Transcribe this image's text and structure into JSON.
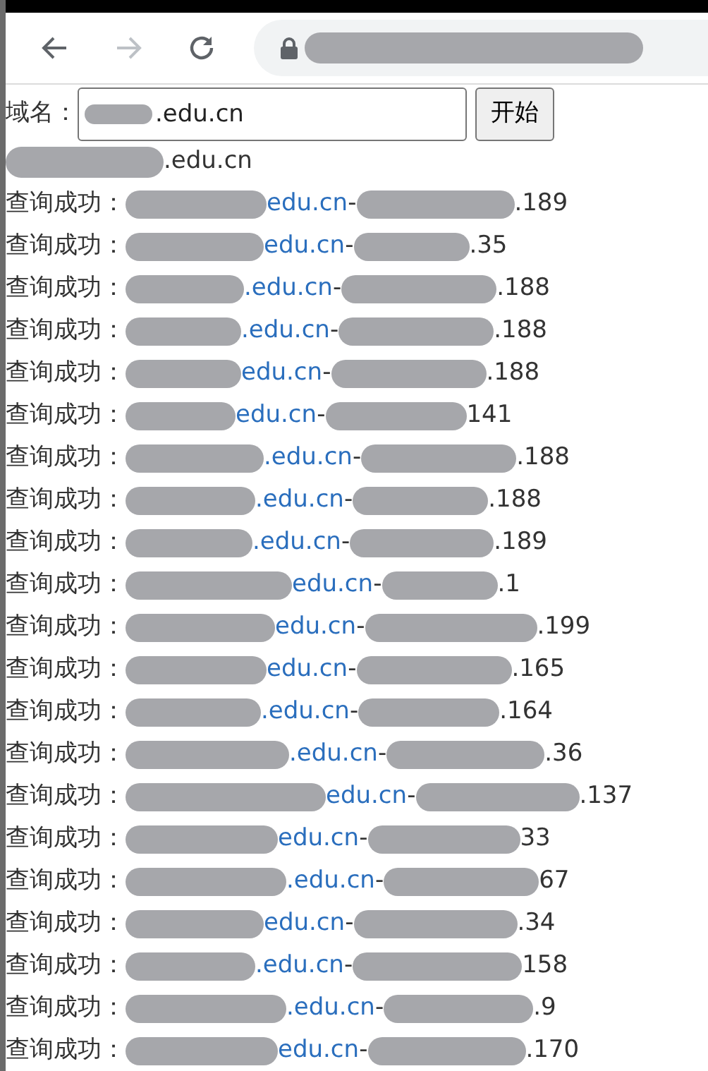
{
  "toolbar": {
    "back_enabled": true,
    "forward_enabled": false
  },
  "form": {
    "label": "域名：",
    "value": ".edu.cn",
    "button": "开始"
  },
  "query_domain": ".edu.cn",
  "results": [
    {
      "label": "查询成功：",
      "domain": "edu.cn",
      "sep": "-",
      "ip": ".189"
    },
    {
      "label": "查询成功：",
      "domain": "edu.cn",
      "sep": "-",
      "ip": ".35"
    },
    {
      "label": "查询成功：",
      "domain": ".edu.cn",
      "sep": "-",
      "ip": ".188"
    },
    {
      "label": "查询成功：",
      "domain": ".edu.cn",
      "sep": "-",
      "ip": ".188"
    },
    {
      "label": "查询成功：",
      "domain": "edu.cn",
      "sep": "-",
      "ip": ".188"
    },
    {
      "label": "查询成功：",
      "domain": "edu.cn",
      "sep": "-",
      "ip": "141"
    },
    {
      "label": "查询成功：",
      "domain": ".edu.cn",
      "sep": "-",
      "ip": ".188"
    },
    {
      "label": "查询成功：",
      "domain": ".edu.cn",
      "sep": "-",
      "ip": ".188"
    },
    {
      "label": "查询成功：",
      "domain": ".edu.cn",
      "sep": "-",
      "ip": ".189"
    },
    {
      "label": "查询成功：",
      "domain": "edu.cn",
      "sep": "-",
      "ip": ".1"
    },
    {
      "label": "查询成功：",
      "domain": "edu.cn",
      "sep": "-",
      "ip": ".199"
    },
    {
      "label": "查询成功：",
      "domain": "edu.cn",
      "sep": "-",
      "ip": ".165"
    },
    {
      "label": "查询成功：",
      "domain": ".edu.cn",
      "sep": "-",
      "ip": ".164"
    },
    {
      "label": "查询成功：",
      "domain": ".edu.cn",
      "sep": "-",
      "ip": ".36"
    },
    {
      "label": "查询成功：",
      "domain": "edu.cn",
      "sep": "-",
      "ip": ".137"
    },
    {
      "label": "查询成功：",
      "domain": "edu.cn",
      "sep": "-",
      "ip": "33"
    },
    {
      "label": "查询成功：",
      "domain": ".edu.cn",
      "sep": "-",
      "ip": "67"
    },
    {
      "label": "查询成功：",
      "domain": "edu.cn",
      "sep": "-",
      "ip": ".34"
    },
    {
      "label": "查询成功：",
      "domain": ".edu.cn",
      "sep": "-",
      "ip": "158"
    },
    {
      "label": "查询成功：",
      "domain": ".edu.cn",
      "sep": "-",
      "ip": ".9"
    },
    {
      "label": "查询成功：",
      "domain": "edu.cn",
      "sep": "-",
      "ip": ".170"
    }
  ]
}
